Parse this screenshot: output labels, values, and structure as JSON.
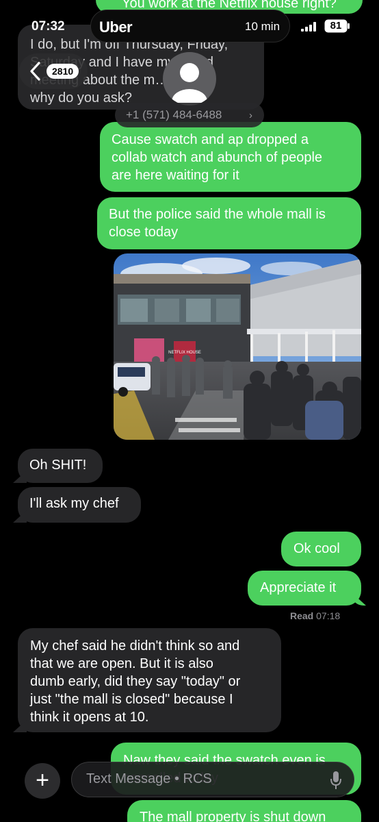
{
  "status_bar": {
    "time": "07:32",
    "live_activity_app": "Uber",
    "live_activity_eta": "10 min",
    "battery": "81"
  },
  "nav": {
    "unread_count": "2810",
    "contact_number": "+1 (571) 484-6488"
  },
  "messages": [
    {
      "id": "m0",
      "from": "me",
      "text": "You work at the Netflix house right?"
    },
    {
      "id": "m1",
      "from": "them",
      "lines": [
        "I do, but I'm off Thursday, Friday,",
        "Saturday and I have my board",
        "meeting about the m…dising,",
        "why do you ask?"
      ]
    },
    {
      "id": "m2",
      "from": "me",
      "lines": [
        "Cause swatch and ap dropped a",
        "collab watch and abunch of people",
        "are here waiting for it"
      ]
    },
    {
      "id": "m3",
      "from": "me",
      "lines": [
        "But the police said the whole mall is",
        "close today"
      ]
    },
    {
      "id": "m4",
      "from": "them",
      "text": "Oh SHIT!"
    },
    {
      "id": "m5",
      "from": "them",
      "text": "I'll ask my chef"
    },
    {
      "id": "m6",
      "from": "me",
      "text": "Ok cool"
    },
    {
      "id": "m7",
      "from": "me",
      "text": "Appreciate it"
    },
    {
      "id": "m8",
      "from": "them",
      "lines": [
        "My chef said he didn't think so and",
        "that we are open. But it is also",
        "dumb early, did they say \"today\" or",
        "just \"the mall is closed\" because I",
        "think it opens at 10."
      ]
    },
    {
      "id": "m9",
      "from": "me",
      "text": "Naw they said the swatch even is cancelled today"
    },
    {
      "id": "m10",
      "from": "me",
      "text": "The mall property is shut down"
    }
  ],
  "receipt": {
    "label": "Read",
    "time": "07:18"
  },
  "photo": {
    "storefront_sign": "NETFLIX HOUSE"
  },
  "composer": {
    "placeholder": "Text Message • RCS"
  },
  "colors": {
    "outgoing_bubble": "#4cd05e",
    "incoming_bubble": "#262628",
    "background": "#000000"
  },
  "icons": [
    "chevron-left-icon",
    "plus-icon",
    "microphone-icon",
    "signal-icon",
    "battery-icon",
    "uber-icon"
  ]
}
